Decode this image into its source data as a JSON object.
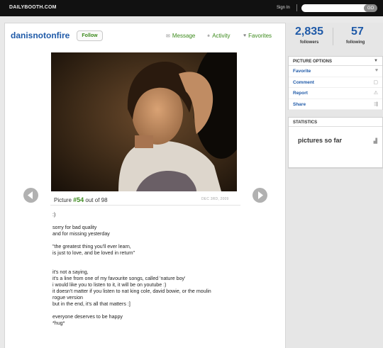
{
  "topbar": {
    "logo": "DAILYBOOTH.COM",
    "signin": "Sign In",
    "search_value": "",
    "go_label": "GO"
  },
  "profile": {
    "username": "danisnotonfire",
    "follow_label": "Follow",
    "actions": {
      "message": "Message",
      "activity": "Activity",
      "favorites": "Favorites"
    },
    "icons": [
      "envelope-icon",
      "activity-icon",
      "heart-icon"
    ]
  },
  "photo": {
    "caption_prefix": "Picture",
    "number": "#54",
    "caption_suffix": "out of 98",
    "date": "DEC 3RD, 2009"
  },
  "description": [
    ":)",
    "",
    "sorry for bad quality",
    "and for missing yesterday",
    "",
    "\"the greatest thing you'll ever learn,",
    "is just to love, and be loved in return\"",
    "",
    "",
    "it's not a saying,",
    "it's a line from one of my favourite songs, called 'nature boy'",
    "i would like you to listen to it, it will be on youtube :)",
    "it doesn't matter if you listen to nat king cole, david bowie, or the moulin",
    "rogue version",
    "but in the end, it's all that matters :]",
    "",
    "everyone deserves to be happy",
    "*hug*"
  ],
  "stats": {
    "followers_count": "2,835",
    "followers_label": "followers",
    "following_count": "57",
    "following_label": "following"
  },
  "picture_options": {
    "title": "PICTURE OPTIONS",
    "items": [
      {
        "label": "Favorite",
        "icon": "heart-icon"
      },
      {
        "label": "Comment",
        "icon": "comment-icon"
      },
      {
        "label": "Report",
        "icon": "report-icon"
      },
      {
        "label": "Share",
        "icon": "share-icon"
      }
    ]
  },
  "statistics": {
    "title": "STATISTICS",
    "pictures_label": "pictures so far",
    "icon": "chart-icon"
  },
  "colors": {
    "link_blue": "#1f5aa8",
    "green": "#3c8a1c",
    "topbar": "#111111"
  }
}
